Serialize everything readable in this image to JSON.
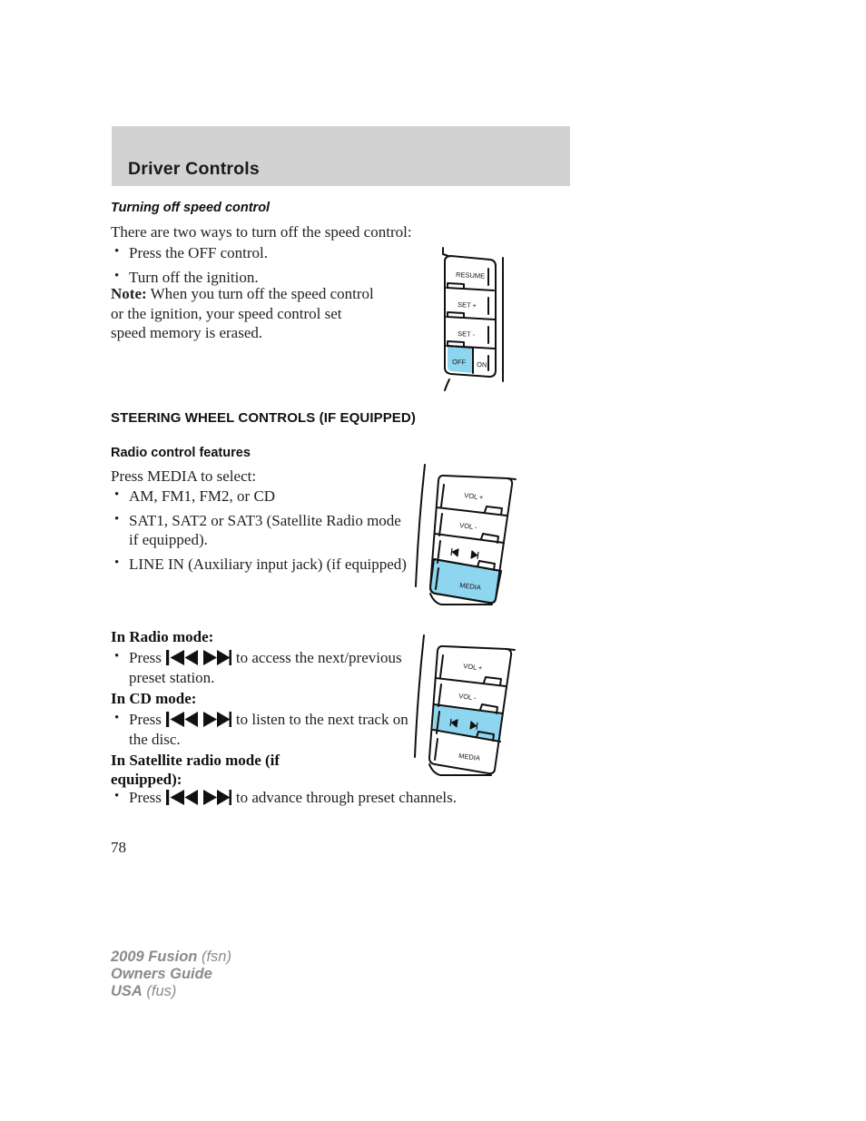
{
  "header": {
    "title": "Driver Controls"
  },
  "sections": {
    "turning_off": {
      "heading": "Turning off speed control",
      "intro": "There are two ways to turn off the speed control:",
      "bullets": [
        "Press the OFF control.",
        "Turn off the ignition."
      ],
      "note_label": "Note:",
      "note_text": " When you turn off the speed control or the ignition, your speed control set speed memory is erased."
    },
    "steering_wheel": {
      "heading": "STEERING WHEEL CONTROLS (IF EQUIPPED)",
      "radio_features": {
        "heading": "Radio control features",
        "intro": "Press MEDIA to select:",
        "bullets": [
          "AM, FM1, FM2, or CD",
          "SAT1, SAT2 or SAT3 (Satellite Radio mode if equipped).",
          "LINE IN (Auxiliary input jack) (if equipped)"
        ]
      },
      "modes": [
        {
          "heading": "In Radio mode:",
          "press_label": "Press",
          "after_text": "to access the next/previous preset station."
        },
        {
          "heading": "In CD mode:",
          "press_label": "Press",
          "after_text": "to listen to the next track on the disc."
        },
        {
          "heading": "In Satellite radio mode (if equipped):",
          "press_label": "Press",
          "after_text": "to advance through preset channels."
        }
      ]
    }
  },
  "figures": {
    "cruise_control": {
      "name": "speed-control-stalk",
      "buttons": [
        "RESUME",
        "SET  +",
        "SET  -",
        "OFF",
        "ON"
      ],
      "highlighted": "OFF"
    },
    "swc_media": {
      "name": "steering-wheel-controls-media",
      "buttons": [
        "VOL  +",
        "VOL  -",
        "SEEK",
        "MEDIA"
      ],
      "highlighted": "MEDIA",
      "seek_prev_icon": "skip-previous-icon",
      "seek_next_icon": "skip-next-icon"
    },
    "swc_seek": {
      "name": "steering-wheel-controls-seek",
      "buttons": [
        "VOL  +",
        "VOL  -",
        "SEEK",
        "MEDIA"
      ],
      "highlighted": "SEEK",
      "seek_prev_icon": "skip-previous-icon",
      "seek_next_icon": "skip-next-icon"
    },
    "labels": {
      "vol_up": "VOL  +",
      "vol_down": "VOL  -",
      "media": "MEDIA",
      "resume": "RESUME",
      "set_plus": "SET  +",
      "set_minus": "SET  -",
      "off": "OFF",
      "on": "ON"
    }
  },
  "footer": {
    "page_number": "78",
    "line1_strong": "2009 Fusion",
    "line1_light": " (fsn)",
    "line2_strong": "Owners Guide",
    "line3_strong": "USA",
    "line3_light": " (fus)"
  },
  "colors": {
    "header_band": "#d2d2d2",
    "highlight_blue": "#8ed6ef",
    "footer_gray": "#8b8b8b",
    "ink": "#1a1a1a"
  }
}
